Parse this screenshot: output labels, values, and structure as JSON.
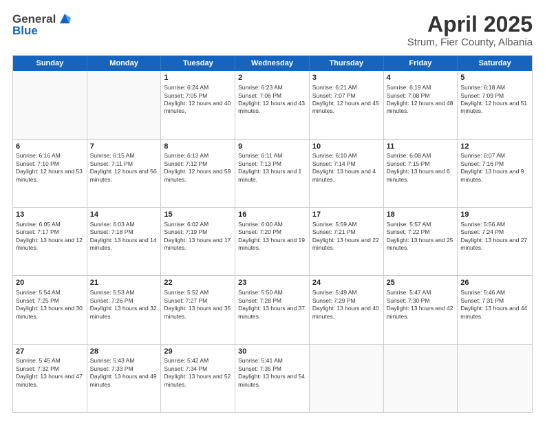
{
  "header": {
    "logo_line1": "General",
    "logo_line2": "Blue",
    "month": "April 2025",
    "location": "Strum, Fier County, Albania"
  },
  "weekdays": [
    "Sunday",
    "Monday",
    "Tuesday",
    "Wednesday",
    "Thursday",
    "Friday",
    "Saturday"
  ],
  "weeks": [
    [
      {
        "day": "",
        "empty": true
      },
      {
        "day": "",
        "empty": true
      },
      {
        "day": "1",
        "sunrise": "Sunrise: 6:24 AM",
        "sunset": "Sunset: 7:05 PM",
        "daylight": "Daylight: 12 hours and 40 minutes."
      },
      {
        "day": "2",
        "sunrise": "Sunrise: 6:23 AM",
        "sunset": "Sunset: 7:06 PM",
        "daylight": "Daylight: 12 hours and 43 minutes."
      },
      {
        "day": "3",
        "sunrise": "Sunrise: 6:21 AM",
        "sunset": "Sunset: 7:07 PM",
        "daylight": "Daylight: 12 hours and 45 minutes."
      },
      {
        "day": "4",
        "sunrise": "Sunrise: 6:19 AM",
        "sunset": "Sunset: 7:08 PM",
        "daylight": "Daylight: 12 hours and 48 minutes."
      },
      {
        "day": "5",
        "sunrise": "Sunrise: 6:18 AM",
        "sunset": "Sunset: 7:09 PM",
        "daylight": "Daylight: 12 hours and 51 minutes."
      }
    ],
    [
      {
        "day": "6",
        "sunrise": "Sunrise: 6:16 AM",
        "sunset": "Sunset: 7:10 PM",
        "daylight": "Daylight: 12 hours and 53 minutes."
      },
      {
        "day": "7",
        "sunrise": "Sunrise: 6:15 AM",
        "sunset": "Sunset: 7:11 PM",
        "daylight": "Daylight: 12 hours and 56 minutes."
      },
      {
        "day": "8",
        "sunrise": "Sunrise: 6:13 AM",
        "sunset": "Sunset: 7:12 PM",
        "daylight": "Daylight: 12 hours and 59 minutes."
      },
      {
        "day": "9",
        "sunrise": "Sunrise: 6:11 AM",
        "sunset": "Sunset: 7:13 PM",
        "daylight": "Daylight: 13 hours and 1 minute."
      },
      {
        "day": "10",
        "sunrise": "Sunrise: 6:10 AM",
        "sunset": "Sunset: 7:14 PM",
        "daylight": "Daylight: 13 hours and 4 minutes."
      },
      {
        "day": "11",
        "sunrise": "Sunrise: 6:08 AM",
        "sunset": "Sunset: 7:15 PM",
        "daylight": "Daylight: 13 hours and 6 minutes."
      },
      {
        "day": "12",
        "sunrise": "Sunrise: 6:07 AM",
        "sunset": "Sunset: 7:16 PM",
        "daylight": "Daylight: 13 hours and 9 minutes."
      }
    ],
    [
      {
        "day": "13",
        "sunrise": "Sunrise: 6:05 AM",
        "sunset": "Sunset: 7:17 PM",
        "daylight": "Daylight: 13 hours and 12 minutes."
      },
      {
        "day": "14",
        "sunrise": "Sunrise: 6:03 AM",
        "sunset": "Sunset: 7:18 PM",
        "daylight": "Daylight: 13 hours and 14 minutes."
      },
      {
        "day": "15",
        "sunrise": "Sunrise: 6:02 AM",
        "sunset": "Sunset: 7:19 PM",
        "daylight": "Daylight: 13 hours and 17 minutes."
      },
      {
        "day": "16",
        "sunrise": "Sunrise: 6:00 AM",
        "sunset": "Sunset: 7:20 PM",
        "daylight": "Daylight: 13 hours and 19 minutes."
      },
      {
        "day": "17",
        "sunrise": "Sunrise: 5:59 AM",
        "sunset": "Sunset: 7:21 PM",
        "daylight": "Daylight: 13 hours and 22 minutes."
      },
      {
        "day": "18",
        "sunrise": "Sunrise: 5:57 AM",
        "sunset": "Sunset: 7:22 PM",
        "daylight": "Daylight: 13 hours and 25 minutes."
      },
      {
        "day": "19",
        "sunrise": "Sunrise: 5:56 AM",
        "sunset": "Sunset: 7:24 PM",
        "daylight": "Daylight: 13 hours and 27 minutes."
      }
    ],
    [
      {
        "day": "20",
        "sunrise": "Sunrise: 5:54 AM",
        "sunset": "Sunset: 7:25 PM",
        "daylight": "Daylight: 13 hours and 30 minutes."
      },
      {
        "day": "21",
        "sunrise": "Sunrise: 5:53 AM",
        "sunset": "Sunset: 7:26 PM",
        "daylight": "Daylight: 13 hours and 32 minutes."
      },
      {
        "day": "22",
        "sunrise": "Sunrise: 5:52 AM",
        "sunset": "Sunset: 7:27 PM",
        "daylight": "Daylight: 13 hours and 35 minutes."
      },
      {
        "day": "23",
        "sunrise": "Sunrise: 5:50 AM",
        "sunset": "Sunset: 7:28 PM",
        "daylight": "Daylight: 13 hours and 37 minutes."
      },
      {
        "day": "24",
        "sunrise": "Sunrise: 5:49 AM",
        "sunset": "Sunset: 7:29 PM",
        "daylight": "Daylight: 13 hours and 40 minutes."
      },
      {
        "day": "25",
        "sunrise": "Sunrise: 5:47 AM",
        "sunset": "Sunset: 7:30 PM",
        "daylight": "Daylight: 13 hours and 42 minutes."
      },
      {
        "day": "26",
        "sunrise": "Sunrise: 5:46 AM",
        "sunset": "Sunset: 7:31 PM",
        "daylight": "Daylight: 13 hours and 44 minutes."
      }
    ],
    [
      {
        "day": "27",
        "sunrise": "Sunrise: 5:45 AM",
        "sunset": "Sunset: 7:32 PM",
        "daylight": "Daylight: 13 hours and 47 minutes."
      },
      {
        "day": "28",
        "sunrise": "Sunrise: 5:43 AM",
        "sunset": "Sunset: 7:33 PM",
        "daylight": "Daylight: 13 hours and 49 minutes."
      },
      {
        "day": "29",
        "sunrise": "Sunrise: 5:42 AM",
        "sunset": "Sunset: 7:34 PM",
        "daylight": "Daylight: 13 hours and 52 minutes."
      },
      {
        "day": "30",
        "sunrise": "Sunrise: 5:41 AM",
        "sunset": "Sunset: 7:35 PM",
        "daylight": "Daylight: 13 hours and 54 minutes."
      },
      {
        "day": "",
        "empty": true
      },
      {
        "day": "",
        "empty": true
      },
      {
        "day": "",
        "empty": true
      }
    ]
  ]
}
